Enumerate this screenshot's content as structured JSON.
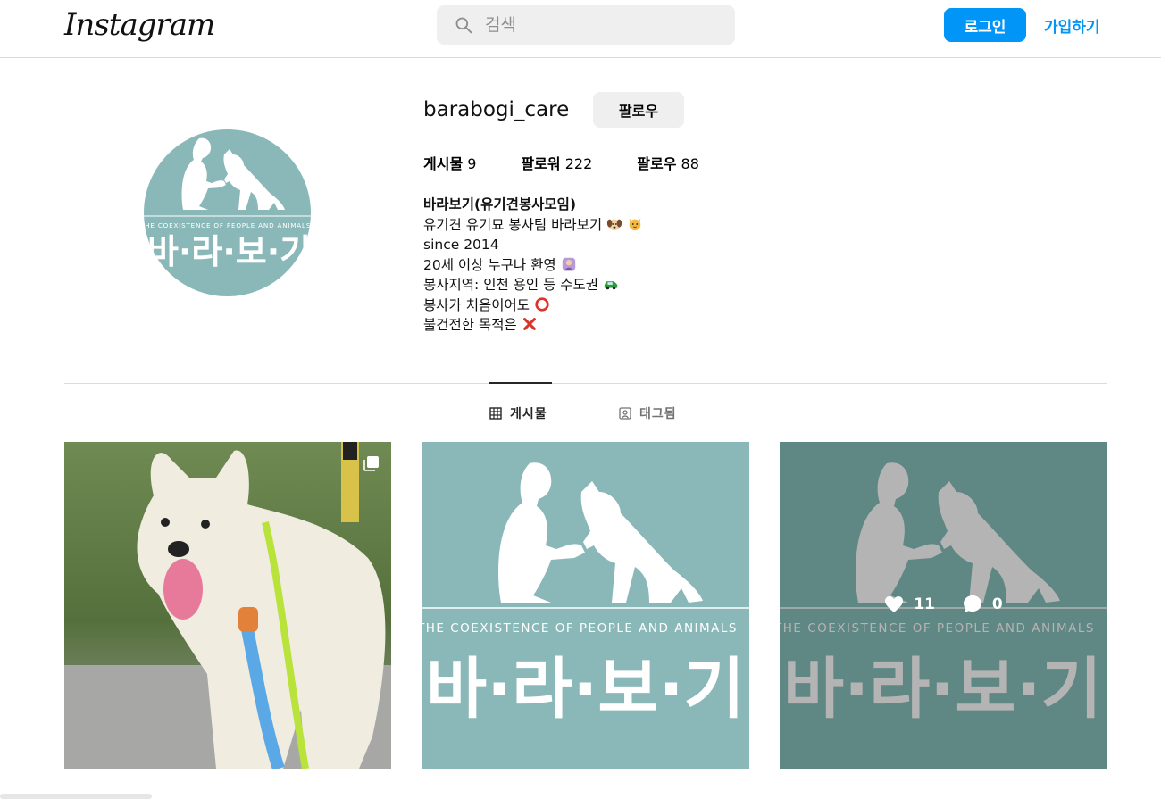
{
  "header": {
    "logo": "Instagram",
    "search_placeholder": "검색",
    "login_label": "로그인",
    "signup_label": "가입하기"
  },
  "profile": {
    "username": "barabogi_care",
    "follow_label": "팔로우",
    "stats": {
      "posts_label": "게시물",
      "posts_count": "9",
      "followers_label": "팔로워",
      "followers_count": "222",
      "following_label": "팔로우",
      "following_count": "88"
    },
    "bio": {
      "name": "바라보기(유기견봉사모임)",
      "line1": "유기견 유기묘 봉사팀 바라보기",
      "line2": "since 2014",
      "line3": "20세 이상 누구나 환영",
      "line4": "봉사지역: 인천 용인 등 수도권",
      "line5": "봉사가 처음이어도",
      "line6": "불건전한 목적은"
    },
    "avatar_brand_text": "바·라·보·기",
    "avatar_tagline": "THE COEXISTENCE OF PEOPLE AND ANIMALS"
  },
  "tabs": {
    "posts_label": "게시물",
    "tagged_label": "태그됨"
  },
  "posts": [
    {
      "type": "photo",
      "subject": "white dog on leash",
      "multi": true
    },
    {
      "type": "logo",
      "tagline": "THE COEXISTENCE OF PEOPLE AND ANIMALS",
      "brand": "바·라·보·기"
    },
    {
      "type": "logo",
      "tagline": "THE COEXISTENCE OF PEOPLE AND ANIMALS",
      "brand": "바·라·보·기",
      "likes": "11",
      "comments": "0"
    }
  ],
  "colors": {
    "accent": "#0095f6",
    "logo_teal": "#8ab8b8",
    "logo_teal_dark": "#5f8784"
  },
  "icons": [
    "search-icon",
    "grid-icon",
    "tag-icon",
    "heart-icon",
    "comment-icon",
    "multi-photo-icon"
  ]
}
